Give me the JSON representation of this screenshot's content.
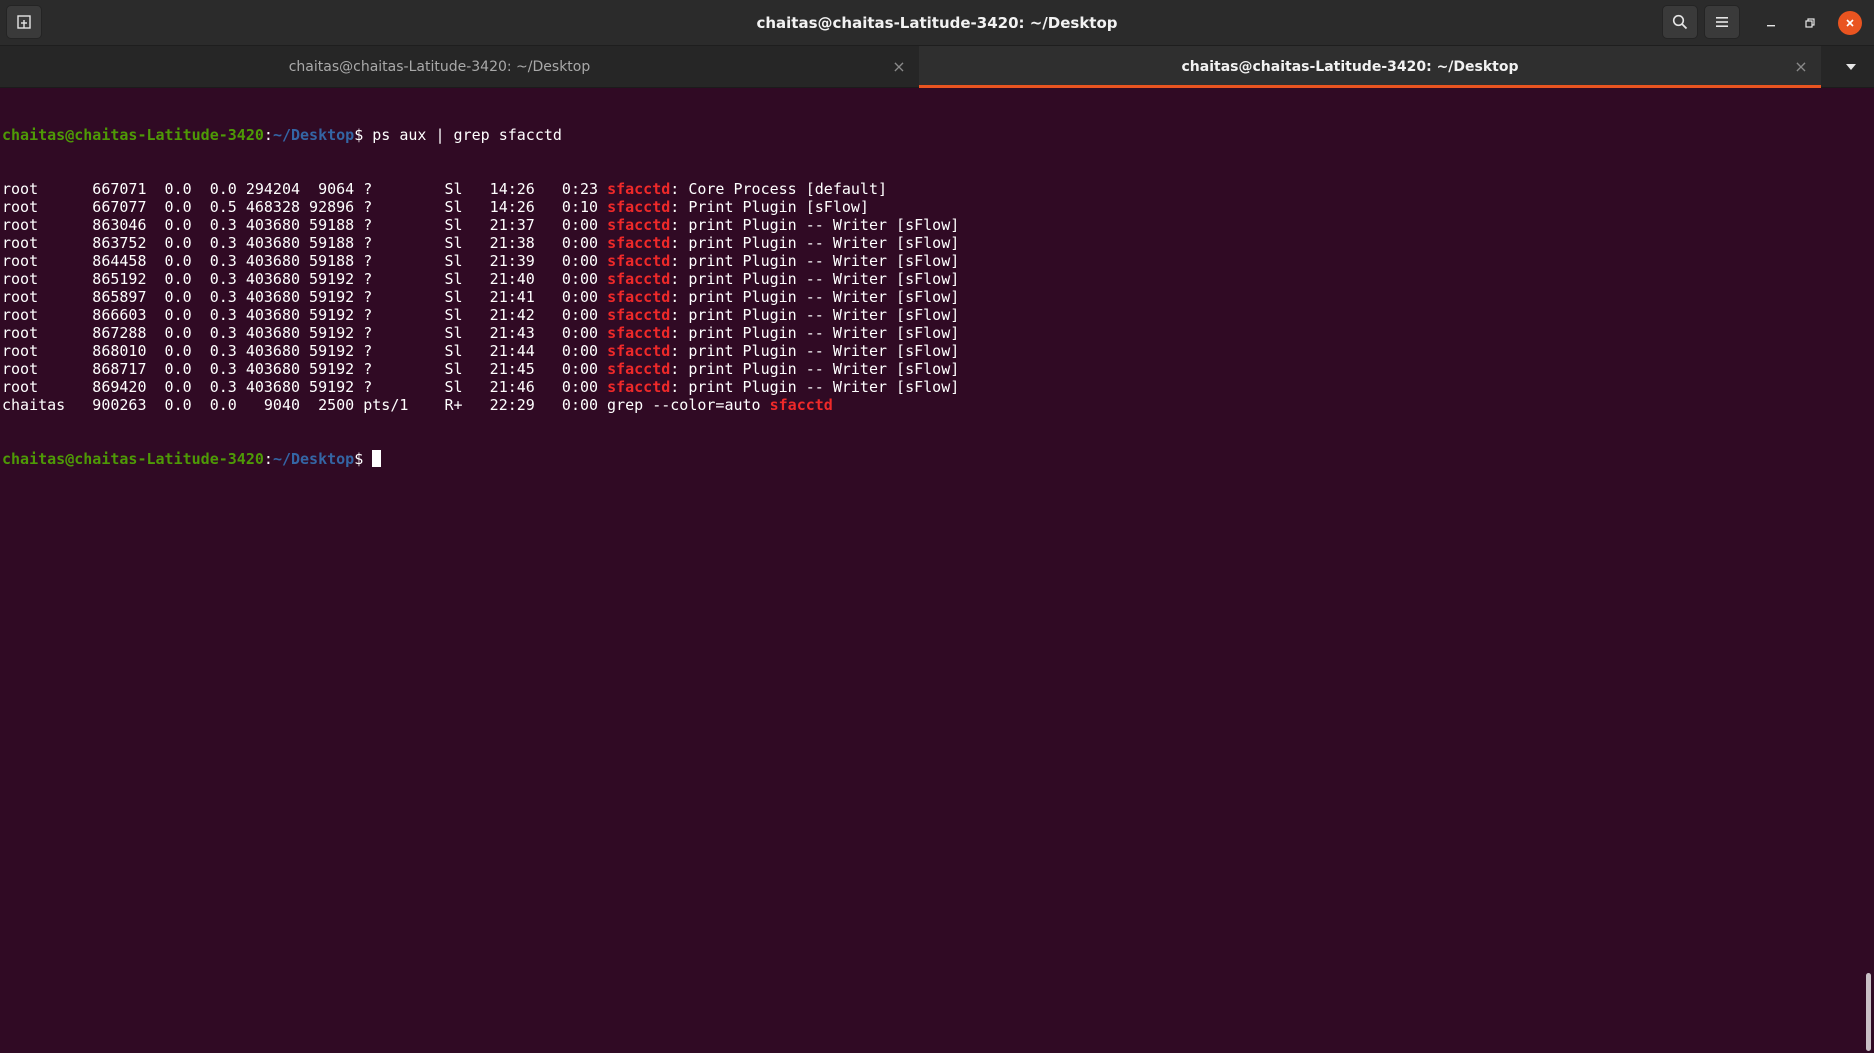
{
  "window": {
    "title": "chaitas@chaitas-Latitude-3420: ~/Desktop"
  },
  "tabs": [
    {
      "label": "chaitas@chaitas-Latitude-3420: ~/Desktop",
      "active": false,
      "close": "×"
    },
    {
      "label": "chaitas@chaitas-Latitude-3420: ~/Desktop",
      "active": true,
      "close": "×"
    }
  ],
  "colors": {
    "background": "#300a24",
    "prompt_user": "#4e9a06",
    "prompt_path": "#3465a4",
    "grep_match": "#ef2929",
    "active_tab_accent": "#e95420"
  },
  "icons": {
    "new_tab": "new-tab-icon",
    "search": "search-icon",
    "menu": "hamburger-menu-icon",
    "minimize": "minimize-icon",
    "maximize": "maximize-icon",
    "close": "close-icon",
    "tab_overflow": "chevron-down-icon"
  },
  "terminal": {
    "prompt": {
      "user_host": "chaitas@chaitas-Latitude-3420",
      "colon": ":",
      "path": "~/Desktop",
      "dollar": "$"
    },
    "command": " ps aux | grep sfacctd",
    "output": [
      {
        "pre": "root      667071  0.0  0.0 294204  9064 ?        Sl   14:26   0:23 ",
        "match": "sfacctd",
        "post": ": Core Process [default]"
      },
      {
        "pre": "root      667077  0.0  0.5 468328 92896 ?        Sl   14:26   0:10 ",
        "match": "sfacctd",
        "post": ": Print Plugin [sFlow]"
      },
      {
        "pre": "root      863046  0.0  0.3 403680 59188 ?        Sl   21:37   0:00 ",
        "match": "sfacctd",
        "post": ": print Plugin -- Writer [sFlow]"
      },
      {
        "pre": "root      863752  0.0  0.3 403680 59188 ?        Sl   21:38   0:00 ",
        "match": "sfacctd",
        "post": ": print Plugin -- Writer [sFlow]"
      },
      {
        "pre": "root      864458  0.0  0.3 403680 59188 ?        Sl   21:39   0:00 ",
        "match": "sfacctd",
        "post": ": print Plugin -- Writer [sFlow]"
      },
      {
        "pre": "root      865192  0.0  0.3 403680 59192 ?        Sl   21:40   0:00 ",
        "match": "sfacctd",
        "post": ": print Plugin -- Writer [sFlow]"
      },
      {
        "pre": "root      865897  0.0  0.3 403680 59192 ?        Sl   21:41   0:00 ",
        "match": "sfacctd",
        "post": ": print Plugin -- Writer [sFlow]"
      },
      {
        "pre": "root      866603  0.0  0.3 403680 59192 ?        Sl   21:42   0:00 ",
        "match": "sfacctd",
        "post": ": print Plugin -- Writer [sFlow]"
      },
      {
        "pre": "root      867288  0.0  0.3 403680 59192 ?        Sl   21:43   0:00 ",
        "match": "sfacctd",
        "post": ": print Plugin -- Writer [sFlow]"
      },
      {
        "pre": "root      868010  0.0  0.3 403680 59192 ?        Sl   21:44   0:00 ",
        "match": "sfacctd",
        "post": ": print Plugin -- Writer [sFlow]"
      },
      {
        "pre": "root      868717  0.0  0.3 403680 59192 ?        Sl   21:45   0:00 ",
        "match": "sfacctd",
        "post": ": print Plugin -- Writer [sFlow]"
      },
      {
        "pre": "root      869420  0.0  0.3 403680 59192 ?        Sl   21:46   0:00 ",
        "match": "sfacctd",
        "post": ": print Plugin -- Writer [sFlow]"
      },
      {
        "pre": "chaitas   900263  0.0  0.0   9040  2500 pts/1    R+   22:29   0:00 grep --color=auto ",
        "match": "sfacctd",
        "post": ""
      }
    ]
  }
}
